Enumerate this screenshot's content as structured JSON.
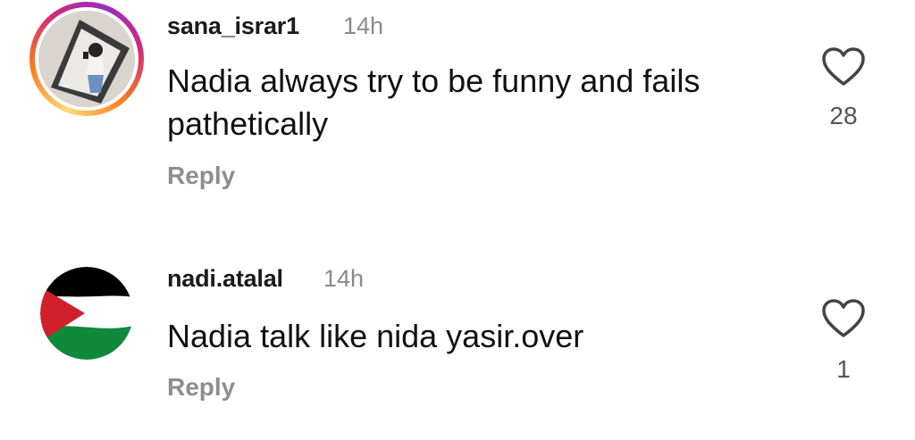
{
  "comments": [
    {
      "username": "sana_israr1",
      "time": "14h",
      "text": "Nadia always try to be funny and fails pathetically",
      "reply_label": "Reply",
      "likes": "28",
      "avatar_ring_colors": [
        "#feda75",
        "#fa7e1e",
        "#d62976",
        "#962fbf"
      ],
      "like_icon": "heart-outline-icon"
    },
    {
      "username": "nadi.atalal",
      "time": "14h",
      "text": "Nadia talk like nida yasir.over",
      "reply_label": "Reply",
      "likes": "1",
      "avatar_colors": [
        "#000000",
        "#ffffff",
        "#007a3d",
        "#ce1126"
      ],
      "like_icon": "heart-outline-icon"
    }
  ],
  "colors": {
    "text": "#111111",
    "muted": "#8e8e8e"
  }
}
